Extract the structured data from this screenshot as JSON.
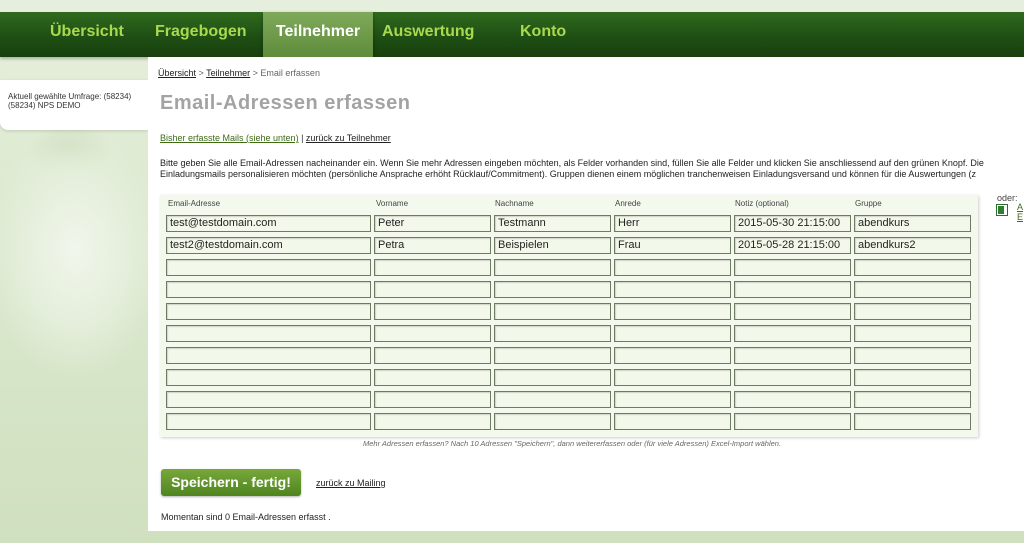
{
  "nav": {
    "items": [
      {
        "label": "Übersicht"
      },
      {
        "label": "Fragebogen"
      },
      {
        "label": "Teilnehmer"
      },
      {
        "label": "Auswertung"
      },
      {
        "label": "Konto"
      }
    ]
  },
  "sidebar": {
    "line1": "Aktuell gewählte Umfrage: (58234)",
    "line2": "(58234) NPS DEMO"
  },
  "breadcrumb": {
    "item1": "Übersicht",
    "sep1": " > ",
    "item2": "Teilnehmer",
    "sep2": " > ",
    "current": "Email erfassen"
  },
  "page": {
    "title": "Email-Adressen erfassen",
    "link_mails": "Bisher erfasste Mails (siehe unten)",
    "link_sep": " | ",
    "link_back": "zurück zu Teilnehmer",
    "intro_line1": "Bitte geben Sie alle Email-Adressen nacheinander ein. Wenn Sie mehr Adressen eingeben möchten, als Felder vorhanden sind, füllen Sie alle Felder und klicken Sie anschliessend auf den grünen Knopf. Die",
    "intro_line2": "Einladungsmails personalisieren möchten (persönliche Ansprache erhöht Rücklauf/Commitment). Gruppen dienen einem möglichen tranchenweisen Einladungsversand und können für die Auswertungen (z"
  },
  "table": {
    "headers": [
      "Email-Adresse",
      "Vorname",
      "Nachname",
      "Anrede",
      "Notiz (optional)",
      "Gruppe"
    ],
    "rows": [
      [
        "test@testdomain.com",
        "Peter",
        "Testmann",
        "Herr",
        "2015-05-30 21:15:00",
        "abendkurs"
      ],
      [
        "test2@testdomain.com",
        "Petra",
        "Beispielen",
        "Frau",
        "2015-05-28 21:15:00",
        "abendkurs2"
      ],
      [
        "",
        "",
        "",
        "",
        "",
        ""
      ],
      [
        "",
        "",
        "",
        "",
        "",
        ""
      ],
      [
        "",
        "",
        "",
        "",
        "",
        ""
      ],
      [
        "",
        "",
        "",
        "",
        "",
        ""
      ],
      [
        "",
        "",
        "",
        "",
        "",
        ""
      ],
      [
        "",
        "",
        "",
        "",
        "",
        ""
      ],
      [
        "",
        "",
        "",
        "",
        "",
        ""
      ],
      [
        "",
        "",
        "",
        "",
        "",
        ""
      ]
    ],
    "note": "Mehr Adressen erfassen? Nach 10 Adressen \"Speichern\", dann weitererfassen oder (für viele Adressen) Excel-Import wählen."
  },
  "side": {
    "oder": "oder:",
    "excel_text": "A E"
  },
  "actions": {
    "save_label": "Speichern - fertig!",
    "back_mailing": "zurück zu Mailing"
  },
  "status": {
    "text": "Momentan sind 0 Email-Adressen erfasst ."
  },
  "icons": {
    "excel": "excel-icon"
  }
}
